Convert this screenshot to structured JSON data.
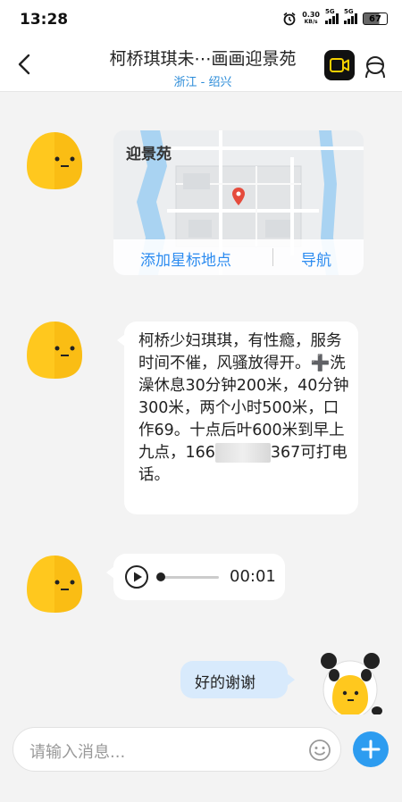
{
  "status": {
    "time": "13:28",
    "net_speed": "0.30",
    "net_unit": "KB/s",
    "sim1": "5G",
    "sim2": "5G",
    "battery": "67"
  },
  "header": {
    "title": "柯桥琪琪未⋯画画迎景苑",
    "subtitle": "浙江 - 绍兴"
  },
  "map_card": {
    "place_name": "迎景苑",
    "add_star_label": "添加星标地点",
    "navigate_label": "导航"
  },
  "message_text": {
    "before_plus": "柯桥少妇琪琪，有性瘾，服务时间不催，风骚放得开。",
    "plus_symbol": "➕",
    "after_plus": "洗澡休息30分钟200米，40分钟300米，两个小时500米，口作69。十点后叶600米到早上九点，166",
    "after_redaction": "367可打电话。"
  },
  "voice_message": {
    "duration": "00:01"
  },
  "outgoing_message": {
    "text": "好的谢谢"
  },
  "composer": {
    "placeholder": "请输入消息..."
  },
  "colors": {
    "accent": "#2d8cf0",
    "outgoing_bubble": "#d8eafc",
    "background": "#f3f3f3"
  }
}
